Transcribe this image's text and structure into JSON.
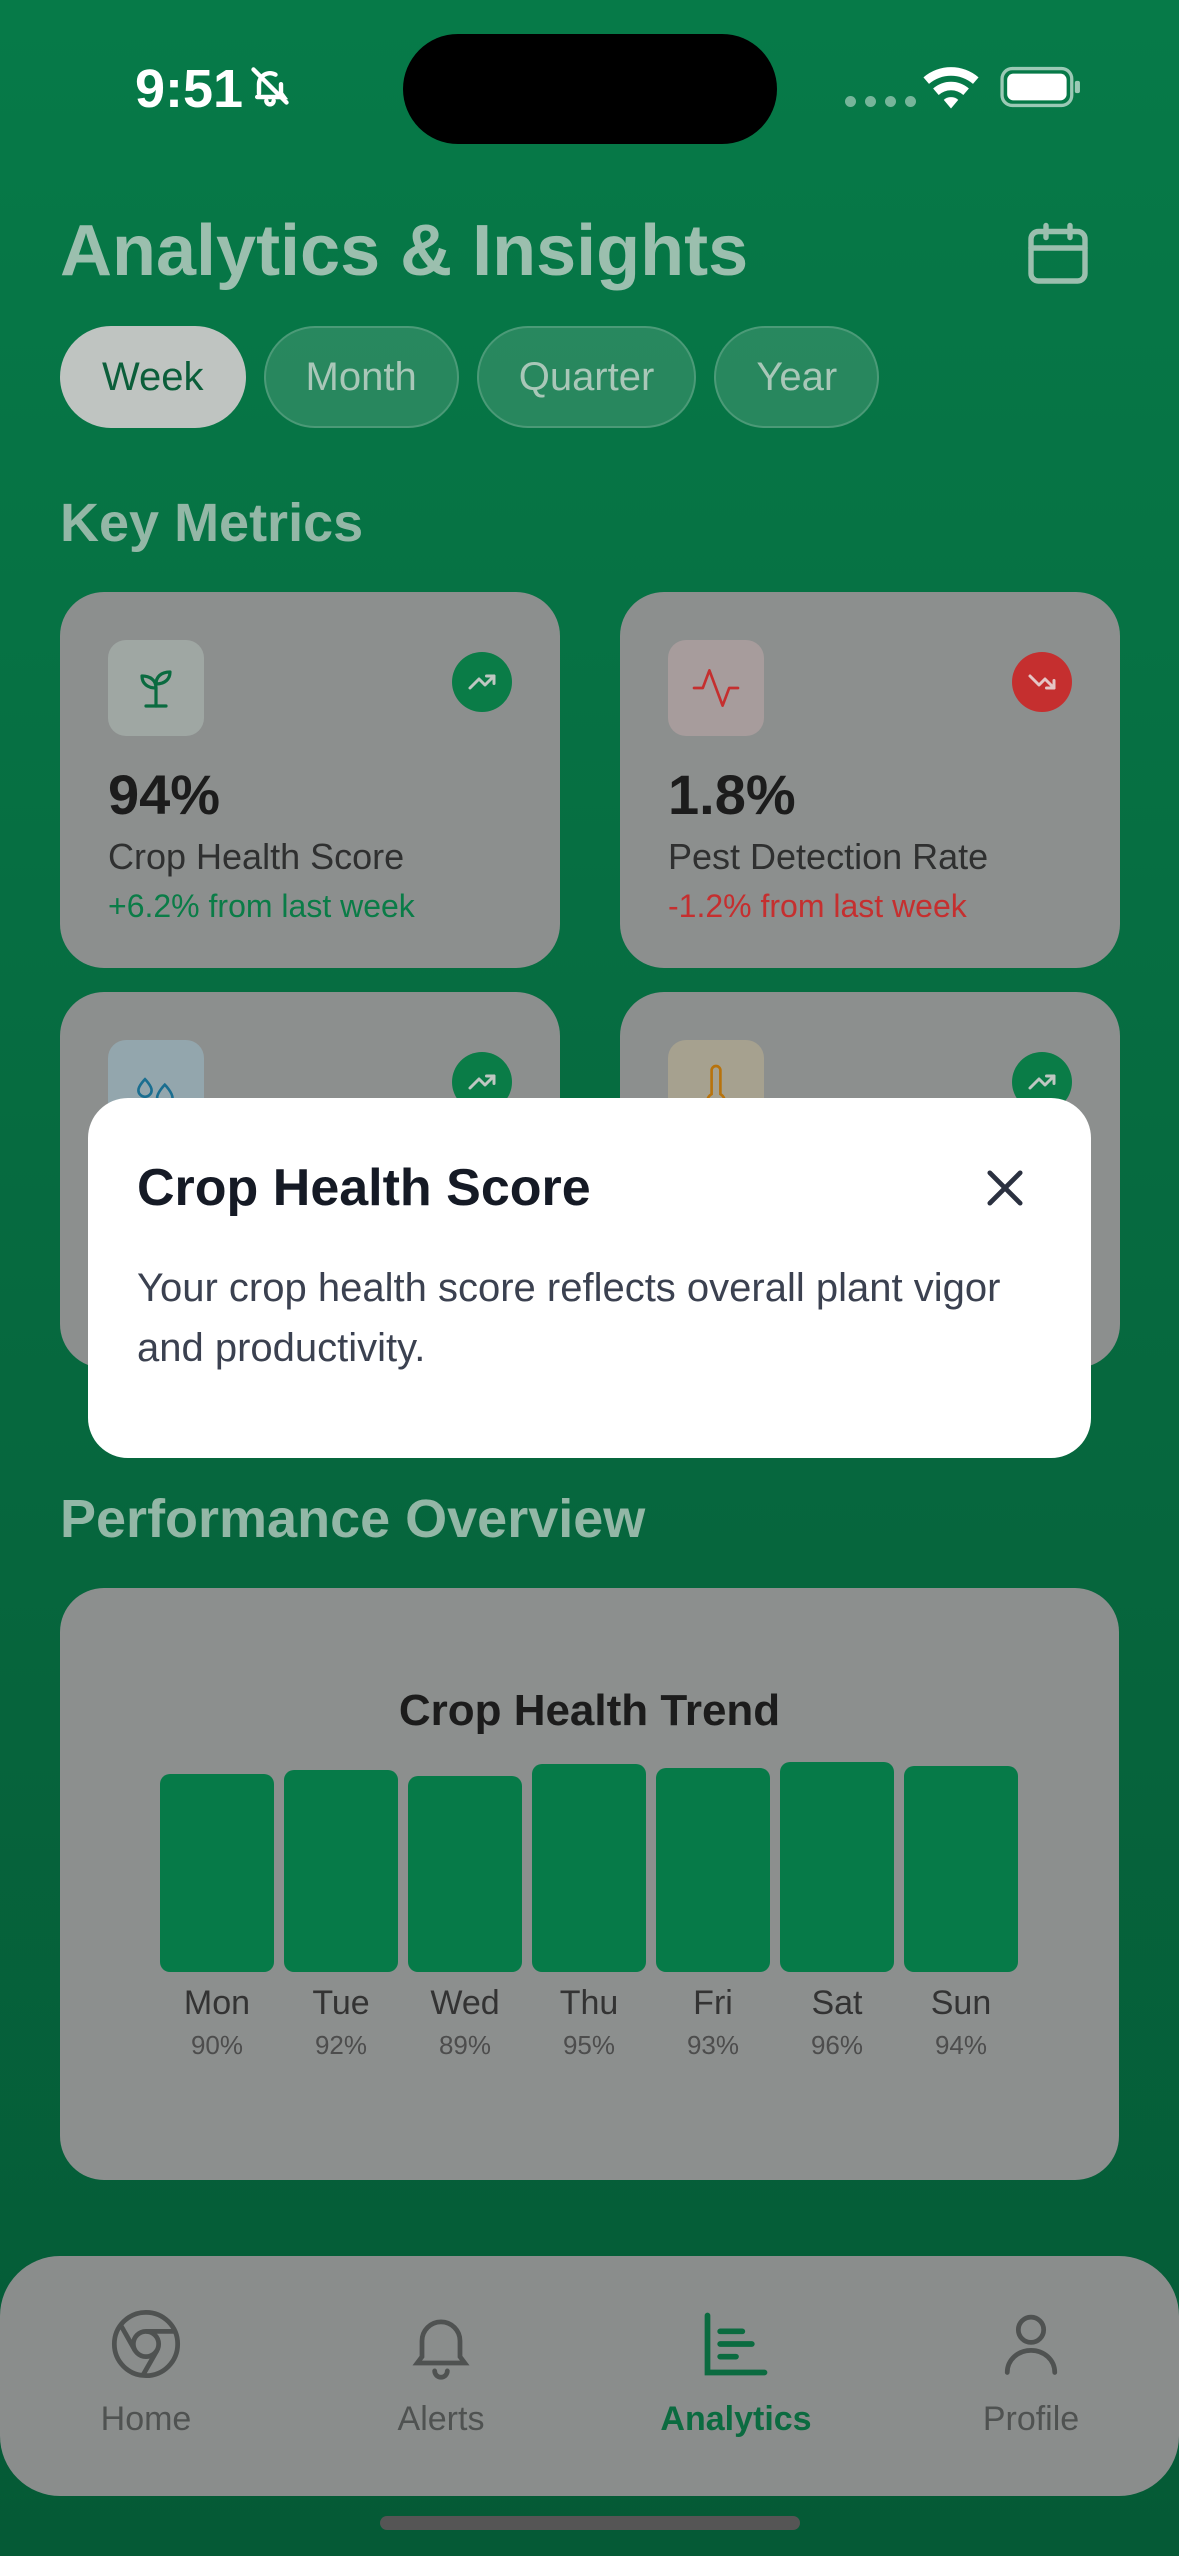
{
  "status": {
    "time": "9:51"
  },
  "header": {
    "title": "Analytics & Insights"
  },
  "periods": {
    "week": "Week",
    "month": "Month",
    "quarter": "Quarter",
    "year": "Year",
    "selected": "Week"
  },
  "key_metrics": {
    "title": "Key Metrics",
    "cards": [
      {
        "value": "94%",
        "label": "Crop Health Score",
        "change": "+6.2% from last week",
        "trend": "up",
        "color": "#0a8a4e",
        "icon": "sprout-icon"
      },
      {
        "value": "1.8%",
        "label": "Pest Detection Rate",
        "change": "-1.2% from last week",
        "trend": "down",
        "color": "#d33a3a",
        "icon": "activity-icon"
      },
      {
        "trend": "up",
        "icon": "droplets-icon"
      },
      {
        "trend": "up",
        "icon": "thermometer-icon"
      }
    ]
  },
  "performance": {
    "title": "Performance Overview",
    "chart_title": "Crop Health Trend"
  },
  "chart_data": {
    "type": "bar",
    "title": "Crop Health Trend",
    "categories": [
      "Mon",
      "Tue",
      "Wed",
      "Thu",
      "Fri",
      "Sat",
      "Sun"
    ],
    "values": [
      90,
      92,
      89,
      95,
      93,
      96,
      94
    ],
    "value_labels": [
      "90%",
      "92%",
      "89%",
      "95%",
      "93%",
      "96%",
      "94%"
    ]
  },
  "modal": {
    "title": "Crop Health Score",
    "body": "Your crop health score reflects overall plant vigor and productivity."
  },
  "nav": {
    "home": "Home",
    "alerts": "Alerts",
    "analytics": "Analytics",
    "profile": "Profile",
    "active": "Analytics"
  },
  "colors": {
    "brand": "#067a48",
    "positive": "#0a8a4e",
    "negative": "#d33a3a",
    "overlay_card": "#8c8f8e"
  }
}
